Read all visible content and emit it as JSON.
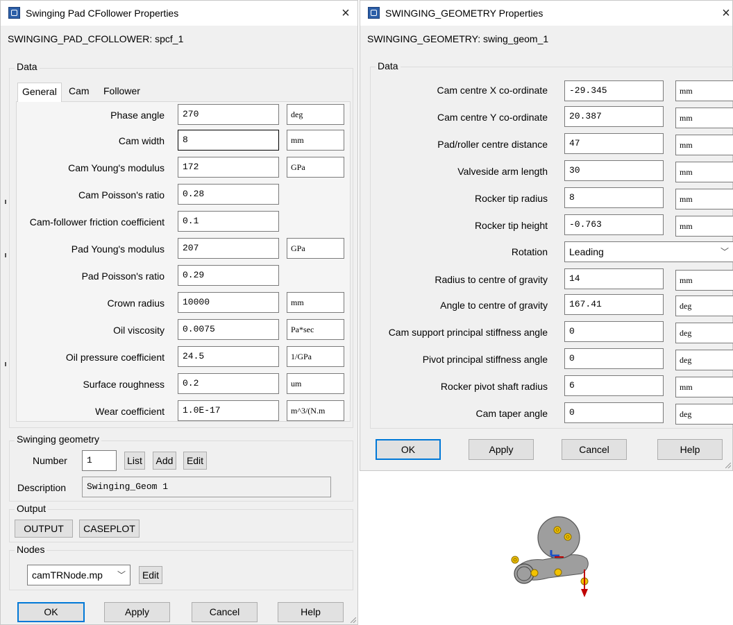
{
  "left_dialog": {
    "title": "Swinging Pad CFollower Properties",
    "close": "×",
    "subtitle": "SWINGING_PAD_CFOLLOWER: spcf_1",
    "data_legend": "Data",
    "tabs": [
      {
        "label": "General"
      },
      {
        "label": "Cam"
      },
      {
        "label": "Follower"
      }
    ],
    "fields": [
      {
        "label": "Phase angle",
        "value": "270",
        "unit": "deg"
      },
      {
        "label": "Cam width",
        "value": "8",
        "unit": "mm"
      },
      {
        "label": "Cam Young's modulus",
        "value": "172",
        "unit": "GPa"
      },
      {
        "label": "Cam Poisson's ratio",
        "value": "0.28"
      },
      {
        "label": "Cam-follower friction coefficient",
        "value": "0.1"
      },
      {
        "label": "Pad Young's modulus",
        "value": "207",
        "unit": "GPa"
      },
      {
        "label": "Pad Poisson's ratio",
        "value": "0.29"
      },
      {
        "label": "Crown radius",
        "value": "10000",
        "unit": "mm"
      },
      {
        "label": "Oil viscosity",
        "value": "0.0075",
        "unit": "Pa*sec"
      },
      {
        "label": "Oil pressure coefficient",
        "value": "24.5",
        "unit": "1/GPa"
      },
      {
        "label": "Surface roughness",
        "value": "0.2",
        "unit": "um"
      },
      {
        "label": "Wear coefficient",
        "value": "1.0E-17",
        "unit": "m^3/(N.m"
      }
    ],
    "swinging_geometry": {
      "legend": "Swinging geometry",
      "number_label": "Number",
      "number_value": "1",
      "list": "List",
      "add": "Add",
      "edit": "Edit",
      "description_label": "Description",
      "description_value": "Swinging_Geom 1"
    },
    "output": {
      "legend": "Output",
      "output_btn": "OUTPUT",
      "caseplot_btn": "CASEPLOT"
    },
    "nodes": {
      "legend": "Nodes",
      "selected": "camTRNode.mp",
      "edit": "Edit"
    },
    "buttons": {
      "ok": "OK",
      "apply": "Apply",
      "cancel": "Cancel",
      "help": "Help"
    }
  },
  "right_dialog": {
    "title": "SWINGING_GEOMETRY Properties",
    "close": "×",
    "subtitle": "SWINGING_GEOMETRY: swing_geom_1",
    "data_legend": "Data",
    "fields": [
      {
        "label": "Cam centre X co-ordinate",
        "value": "-29.345",
        "unit": "mm"
      },
      {
        "label": "Cam centre Y co-ordinate",
        "value": "20.387",
        "unit": "mm"
      },
      {
        "label": "Pad/roller centre distance",
        "value": "47",
        "unit": "mm"
      },
      {
        "label": "Valveside arm length",
        "value": "30",
        "unit": "mm"
      },
      {
        "label": "Rocker tip radius",
        "value": "8",
        "unit": "mm"
      },
      {
        "label": "Rocker tip height",
        "value": "-0.763",
        "unit": "mm"
      },
      {
        "label": "Rotation",
        "value": "Leading"
      },
      {
        "label": "Radius to centre of gravity",
        "value": "14",
        "unit": "mm"
      },
      {
        "label": "Angle to centre of gravity",
        "value": "167.41",
        "unit": "deg"
      },
      {
        "label": "Cam support principal stiffness angle",
        "value": "0",
        "unit": "deg"
      },
      {
        "label": "Pivot principal stiffness angle",
        "value": "0",
        "unit": "deg"
      },
      {
        "label": "Rocker pivot shaft radius",
        "value": "6",
        "unit": "mm"
      },
      {
        "label": "Cam taper angle",
        "value": "0",
        "unit": "deg"
      }
    ],
    "buttons": {
      "ok": "OK",
      "apply": "Apply",
      "cancel": "Cancel",
      "help": "Help"
    }
  },
  "colors": {
    "dialog_bg": "#f0f0f0",
    "default_button_border": "#0078d7",
    "diagram_body": "#9e9e9e",
    "diagram_marker": "#f2c200",
    "diagram_arrow": "#c00000"
  }
}
